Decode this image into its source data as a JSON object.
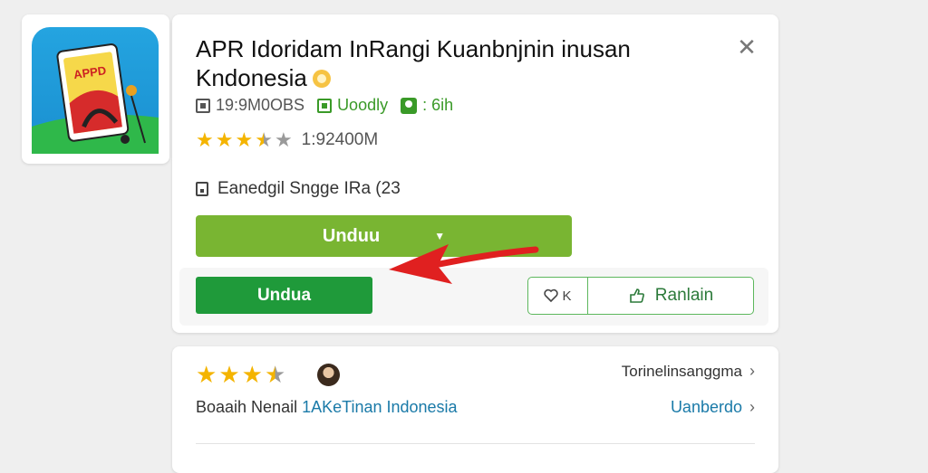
{
  "app_icon": {
    "label": "APPD"
  },
  "header": {
    "title_line1": "APR Idoridam InRangi Kuanbnjnin inusan",
    "title_line2": "Kndonesia",
    "close_symbol": "✕"
  },
  "meta": {
    "size": "19:9M0OBS",
    "category": "Uoodly",
    "age": ": 6ih"
  },
  "rating": {
    "value": 3.5,
    "max": 5,
    "text": "1:92400M"
  },
  "info": {
    "text": "Eanedgil Sngge IRa (23"
  },
  "buttons": {
    "download_wide": "Unduu",
    "download_wide_caret": "▼",
    "download": "Undua",
    "favorite_label": "K",
    "share_label": "Ranlain"
  },
  "review_card": {
    "stars": 3.5,
    "right_link1": "Torinelinsanggma",
    "text_prefix": "Boaaih Nenail ",
    "text_link": "1AKeTinan Indonesia",
    "right_link2": "Uanberdo"
  },
  "colors": {
    "primary_green": "#1f9a3a",
    "light_green": "#79b532",
    "star": "#f4b400",
    "annotation_red": "#e02020"
  },
  "icons": [
    "close-icon",
    "storage-icon",
    "category-icon",
    "age-icon",
    "star-icon",
    "info-icon",
    "heart-icon",
    "share-icon",
    "chevron-right-icon",
    "avatar"
  ]
}
